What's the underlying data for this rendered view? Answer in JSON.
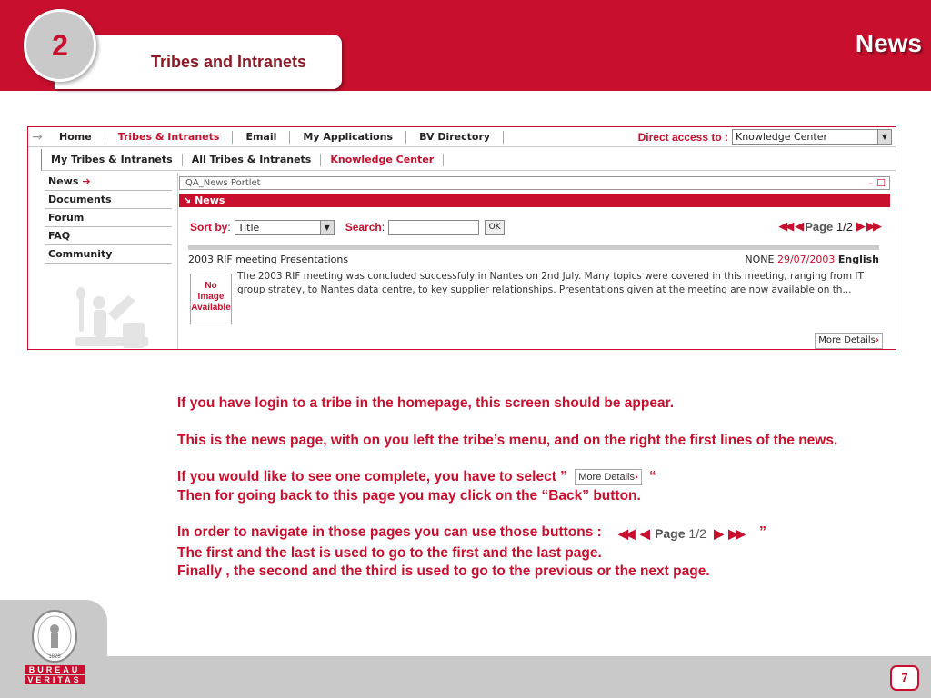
{
  "header": {
    "section_number": "2",
    "section_title": "Tribes and Intranets",
    "page_title": "News"
  },
  "screenshot": {
    "top_nav": [
      "Home",
      "Tribes & Intranets",
      "Email",
      "My Applications",
      "BV Directory"
    ],
    "top_nav_active": "Tribes & Intranets",
    "direct_access_label": "Direct access to :",
    "direct_access_value": "Knowledge Center",
    "sub_nav": [
      "My Tribes & Intranets",
      "All Tribes & Intranets",
      "Knowledge Center"
    ],
    "left_menu": [
      "News",
      "Documents",
      "Forum",
      "FAQ",
      "Community"
    ],
    "portlet_title": "QA_News Portlet",
    "portlet_controls": "– ☐",
    "news_bar": "News",
    "sort_label": "Sort by",
    "sort_colon": ":",
    "sort_value": "Title",
    "search_label": "Search",
    "search_colon": ":",
    "ok_button": "OK",
    "pager_label": "Page",
    "pager_value": "1/2",
    "headline": "2003 RIF meeting Presentations",
    "meta_none": "NONE",
    "meta_date": "29/07/2003",
    "meta_lang": "English",
    "no_image": "No Image Available",
    "summary": "The 2003 RIF meeting was concluded successfuly in Nantes on 2nd July. Many topics were covered in this meeting, ranging from IT group stratey, to Nantes data centre, to key supplier relationships. Presentations given at the meeting are now available on th...",
    "more_details": "More Details"
  },
  "explanation": {
    "p1": "If you have login to a tribe in the homepage, this screen should be appear.",
    "p2": "This is the news page, with on you left the tribe’s menu, and on the right the first lines of the news.",
    "p3a": "If you would like to see one complete, you have to select ”",
    "p3b": "“",
    "p3c": "Then for going back to this page you may click on the “Back” button.",
    "p4a": "In order to navigate in those pages you can use those buttons :",
    "p4b": "”",
    "p4c": "The first and the last is used to go to the first and the last page.",
    "p4d": "Finally , the second and the third is used to go to the previous or the next page."
  },
  "footer": {
    "logo_line1": "BUREAU",
    "logo_line2": "VERITAS",
    "logo_year": "1828",
    "page_number": "7"
  },
  "colors": {
    "brand_red": "#c8102e",
    "footer_gray": "#c9c9c9"
  }
}
